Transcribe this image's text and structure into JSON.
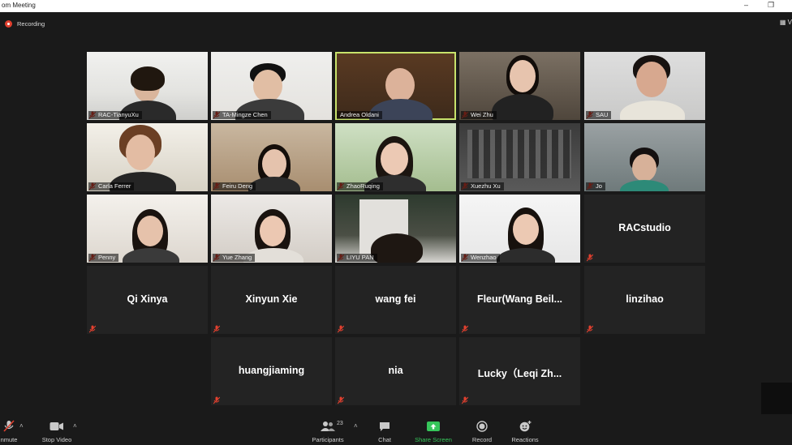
{
  "window": {
    "title": "om Meeting",
    "minimize_icon": "minimize-icon",
    "restore_icon": "restore-icon"
  },
  "recording": {
    "label": "Recording",
    "color": "#e2402f"
  },
  "view_button": {
    "label": "V"
  },
  "active_speaker_color": "#c8e26b",
  "video_tiles": [
    {
      "name": "RAC-TianyuXu"
    },
    {
      "name": "TA-Mingze Chen"
    },
    {
      "name": "Andrea Oldani"
    },
    {
      "name": "Wei Zhu"
    },
    {
      "name": "SAU"
    },
    {
      "name": "Carla Ferrer"
    },
    {
      "name": "Feiru Deng"
    },
    {
      "name": "ZhaoRuqing"
    },
    {
      "name": "Xuezhu Xu"
    },
    {
      "name": "Jo"
    },
    {
      "name": "Penny"
    },
    {
      "name": "Yue Zhang"
    },
    {
      "name": "LIYU PAN"
    },
    {
      "name": "Wenzhao"
    }
  ],
  "name_tiles": [
    {
      "name": "RACstudio"
    },
    {
      "name": "Qi Xinya"
    },
    {
      "name": "Xinyun Xie"
    },
    {
      "name": "wang fei"
    },
    {
      "name": "Fleur(Wang  Beil..."
    },
    {
      "name": "linzihao"
    },
    {
      "name": "huangjiaming"
    },
    {
      "name": "nia"
    },
    {
      "name": "Lucky（Leqi Zh..."
    }
  ],
  "toolbar": {
    "unmute": "nmute",
    "stop_video": "Stop Video",
    "participants": "Participants",
    "participants_count": "23",
    "chat": "Chat",
    "share_screen": "Share Screen",
    "record": "Record",
    "reactions": "Reactions",
    "share_color": "#36c65a"
  }
}
